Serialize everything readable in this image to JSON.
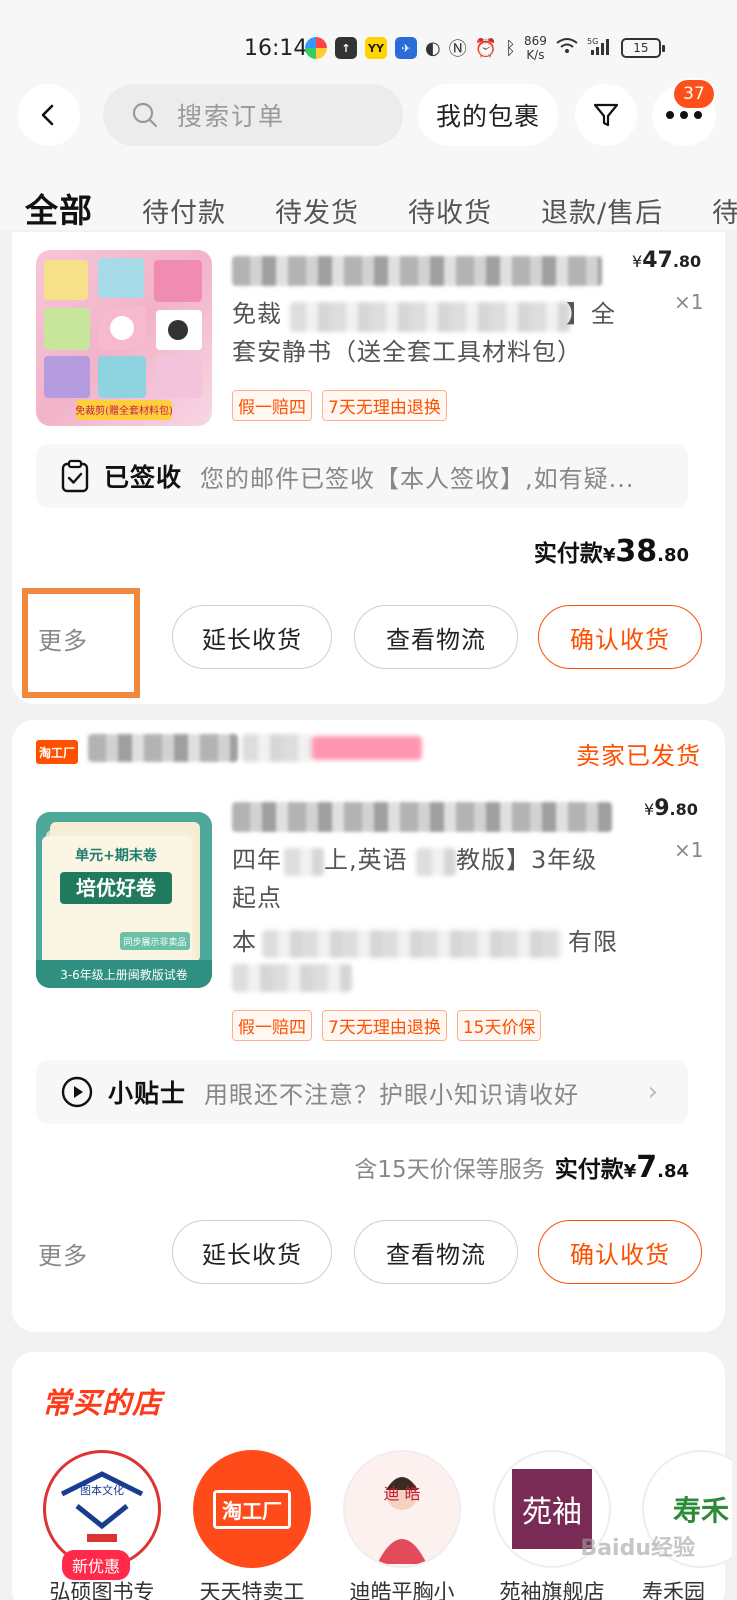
{
  "status_bar": {
    "time": "16:14",
    "net_speed_value": "869",
    "net_speed_unit": "K/s",
    "battery": "15",
    "network": "5G"
  },
  "header": {
    "search_placeholder": "搜索订单",
    "parcel_label": "我的包裹",
    "badge_count": "37"
  },
  "tabs": [
    {
      "label": "全部",
      "active": true
    },
    {
      "label": "待付款"
    },
    {
      "label": "待发货"
    },
    {
      "label": "待收货"
    },
    {
      "label": "退款/售后"
    },
    {
      "label": "待"
    }
  ],
  "orders": [
    {
      "price_symbol": "¥",
      "price_int": "47",
      "price_dec": ".80",
      "qty": "×1",
      "desc_line1": "免裁",
      "desc_line1_tail": "】全",
      "desc_line2": "套安静书（送全套工具材料包）",
      "thumb_caption": "免裁剪(赠全套材料包)",
      "tags": [
        "假一赔四",
        "7天无理由退换"
      ],
      "info_title": "已签收",
      "info_text": "您的邮件已签收【本人签收】,如有疑...",
      "paid_label": "实付款",
      "paid_symbol": "¥",
      "paid_int": "38",
      "paid_dec": ".80",
      "more": "更多",
      "buttons": [
        "延长收货",
        "查看物流",
        "确认收货"
      ]
    },
    {
      "shop_logo": "淘工厂",
      "shop_status": "卖家已发货",
      "price_symbol": "¥",
      "price_int": "9",
      "price_dec": ".80",
      "qty": "×1",
      "desc_line1_a": "四年",
      "desc_line1_b": "上,英语",
      "desc_line1_c": "教版】3年级",
      "desc_line2": "起点",
      "desc_line3_a": "本",
      "desc_line3_b": "有限",
      "thumb_title": "单元+期末卷",
      "thumb_big": "培优好卷",
      "thumb_bottom": "3-6年级上册闽教版试卷",
      "thumb_sticker": "同步展示非卖品",
      "tags": [
        "假一赔四",
        "7天无理由退换",
        "15天价保"
      ],
      "info_title": "小贴士",
      "info_text": "用眼还不注意？护眼小知识请收好",
      "service_text": "含15天价保等服务",
      "paid_label": "实付款",
      "paid_symbol": "¥",
      "paid_int": "7",
      "paid_dec": ".84",
      "more": "更多",
      "buttons": [
        "延长收货",
        "查看物流",
        "确认收货"
      ]
    }
  ],
  "frequent_stores": {
    "title": "常买的店",
    "badge": "新优惠",
    "stores": [
      {
        "name": "弘硕图书专",
        "logo_text": "图本文化"
      },
      {
        "name": "天天特卖工",
        "logo_text": "淘工厂"
      },
      {
        "name": "迪皓平胸小",
        "logo_text": "迪 皓"
      },
      {
        "name": "苑袖旗舰店",
        "logo_text": "苑袖"
      },
      {
        "name": "寿禾园",
        "logo_text": "寿禾"
      }
    ]
  },
  "watermark": "Baidu经验",
  "colors": {
    "accent": "#ff5000",
    "badge": "#ff4f1a",
    "highlight_box": "#f0883e",
    "section_title": "#ff3a1a"
  },
  "icons": [
    "back-arrow-icon",
    "search-icon",
    "filter-icon",
    "more-dots-icon",
    "clipboard-check-icon",
    "play-circle-icon",
    "chevron-right-icon"
  ]
}
